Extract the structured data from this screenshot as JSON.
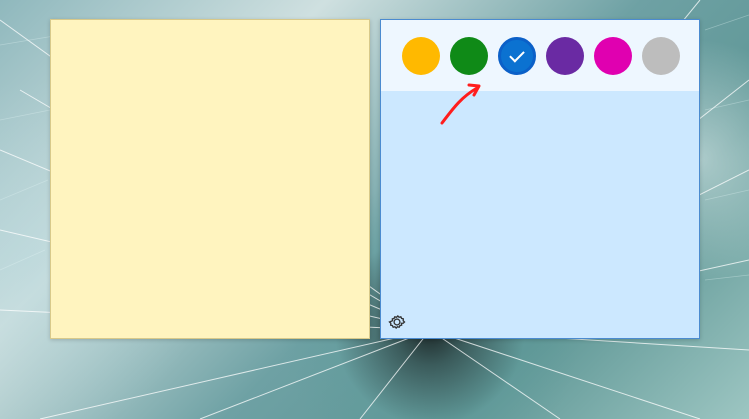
{
  "notes": {
    "left": {
      "color": "#fff4bf"
    },
    "right": {
      "color": "#cce8ff",
      "swatches": [
        {
          "name": "yellow",
          "color": "#ffb900",
          "selected": false
        },
        {
          "name": "green",
          "color": "#0f8a17",
          "selected": false
        },
        {
          "name": "blue",
          "color": "#0b72d1",
          "selected": true
        },
        {
          "name": "purple",
          "color": "#6a2aa3",
          "selected": false
        },
        {
          "name": "pink",
          "color": "#e000b0",
          "selected": false
        },
        {
          "name": "gray",
          "color": "#bdbdbd",
          "selected": false
        }
      ]
    }
  },
  "icons": {
    "settings": "gear-icon",
    "check": "check-icon",
    "annotation": "red-arrow-annotation"
  },
  "colors": {
    "selection_border": "#0b60c8",
    "menu_background": "#eef7ff",
    "annotation": "#ff1d1d"
  }
}
